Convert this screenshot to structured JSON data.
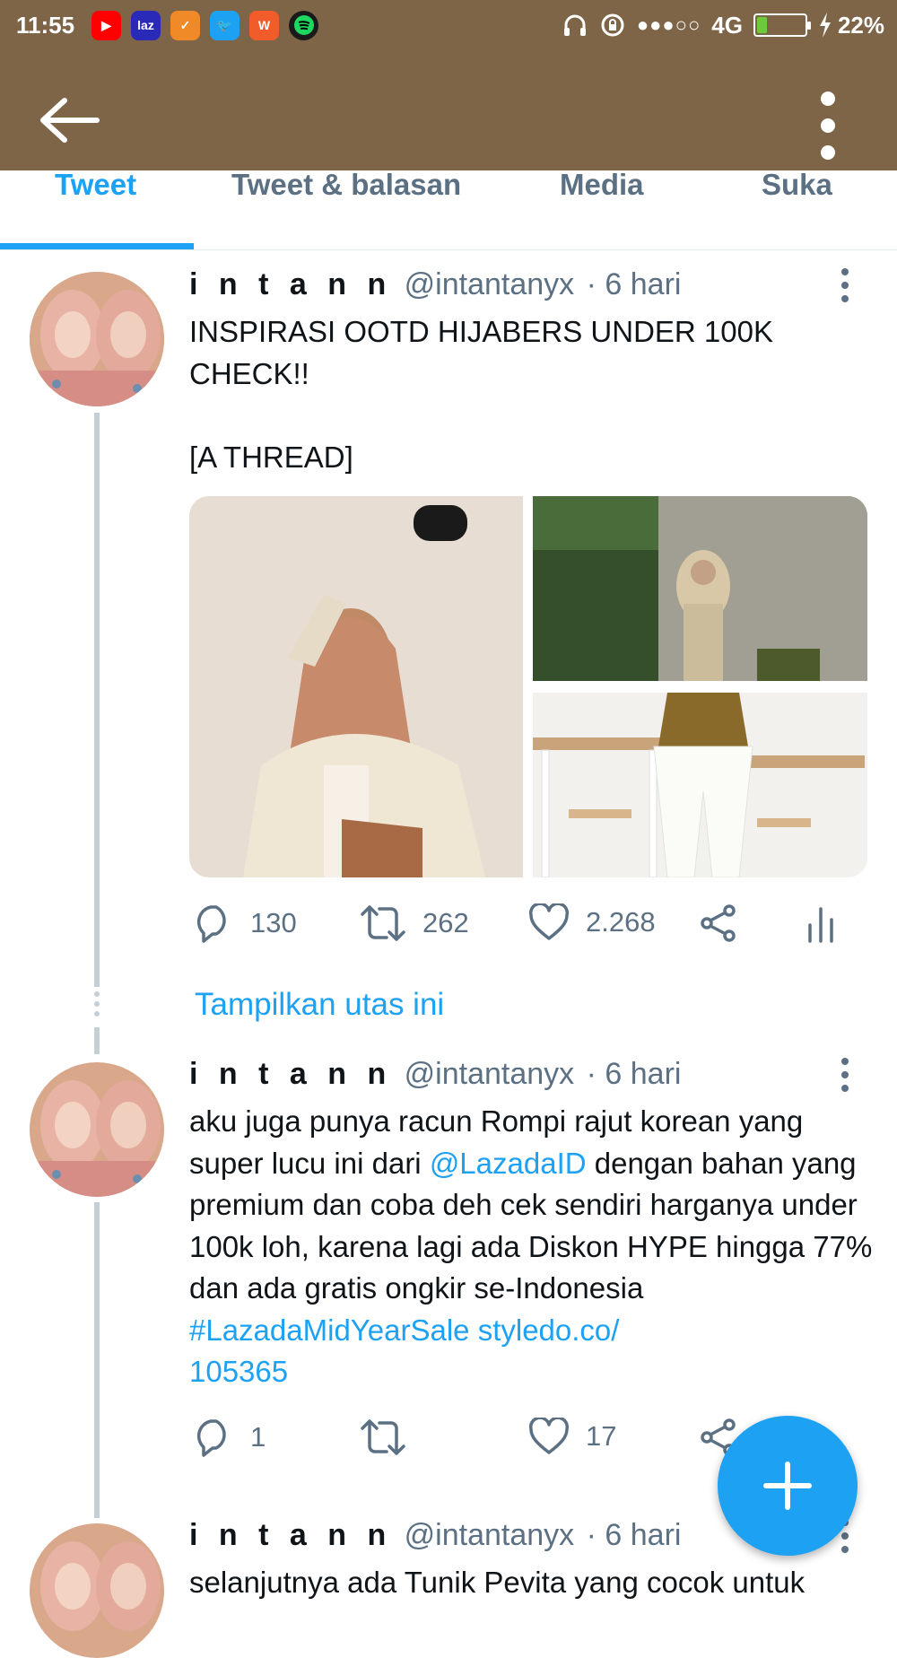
{
  "statusbar": {
    "time": "11:55",
    "network": "4G",
    "battery_percent": "22%",
    "battery_level": 0.22,
    "signal_dots": "●●●○○",
    "app_icons": [
      "youtube-icon",
      "lazada-icon",
      "shopee-icon",
      "twitter-icon",
      "webtoon-icon",
      "spotify-icon"
    ]
  },
  "appbar": {
    "color": "#7e6548"
  },
  "tabs": [
    {
      "label": "Tweet",
      "active": true
    },
    {
      "label": "Tweet & balasan",
      "active": false
    },
    {
      "label": "Media",
      "active": false
    },
    {
      "label": "Suka",
      "active": false
    }
  ],
  "tweets": [
    {
      "name": "i n t a n n",
      "handle": "@intantanyx",
      "time": "· 6 hari",
      "text": "INSPIRASI OOTD HIJABERS UNDER 100K\nCHECK!!\n\n[A THREAD]",
      "replies": "130",
      "retweets": "262",
      "likes": "2.268"
    },
    {
      "name": "i n t a n n",
      "handle": "@intantanyx",
      "time": "· 6 hari",
      "text_parts": [
        "aku juga punya racun Rompi rajut korean yang super lucu ini dari ",
        "@LazadaID",
        " dengan bahan yang premium dan coba deh cek sendiri harganya under 100k loh, karena lagi ada Diskon HYPE hingga 77%  dan ada gratis ongkir se-Indonesia ",
        "#LazadaMidYearSale",
        " ",
        "styledo.co/\n105365"
      ],
      "replies": "1",
      "retweets": "",
      "likes": "17"
    },
    {
      "name": "i n t a n n",
      "handle": "@intantanyx",
      "time": "· 6 hari",
      "text": "selanjutnya ada Tunik Pevita yang cocok untuk"
    }
  ],
  "show_thread": "Tampilkan utas ini",
  "accent_color": "#1da1f2"
}
